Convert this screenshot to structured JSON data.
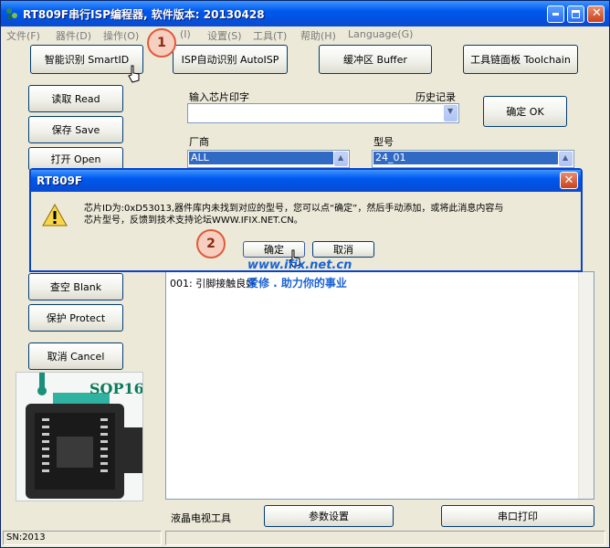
{
  "window": {
    "title": "RT809F串行ISP编程器, 软件版本: 20130428"
  },
  "menu": [
    "文件(F)",
    "器件(D)",
    "操作(O)",
    "(I)",
    "设置(S)",
    "工具(T)",
    "帮助(H)",
    "Language(G)"
  ],
  "toolbar": {
    "smartid": "智能识别 SmartID",
    "isp_auto": "ISP自动识别 AutoISP",
    "buffer": "缓冲区 Buffer",
    "toolchain": "工具链面板 Toolchain"
  },
  "sidebar": {
    "read": "读取 Read",
    "save": "保存 Save",
    "open": "打开 Open",
    "blank": "查空 Blank",
    "protect": "保护 Protect",
    "cancel": "取消 Cancel"
  },
  "chip_input": {
    "label": "输入芯片印字",
    "history_label": "历史记录",
    "value": "",
    "confirm": "确定 OK"
  },
  "vendor": {
    "label": "厂商",
    "selected": "ALL"
  },
  "model": {
    "label": "型号",
    "selected": "24_01"
  },
  "log": {
    "lines": [
      "001: 引脚接触良好"
    ]
  },
  "bottom_bar": {
    "lcd_tools": "液晶电视工具",
    "params": "参数设置",
    "serial_print": "串口打印"
  },
  "status": {
    "sn": "SN:2013",
    "message": ""
  },
  "package_photo": {
    "label": "SOP16"
  },
  "dialog": {
    "title": "RT809F",
    "message_line1": "芯片ID为:0xD53013,器件库内未找到对应的型号，您可以点“确定”，然后手动添加，或将此消息内容与",
    "message_line2": "芯片型号，反馈到技术支持论坛WWW.IFIX.NET.CN。",
    "ok": "确定",
    "cancel": "取消"
  },
  "callouts": {
    "step1": "1",
    "step2": "2"
  },
  "watermark": {
    "url": "www.ifix.net.cn",
    "slogan": "爱修 . 助力你的事业"
  },
  "icons": {
    "warning": "warning-icon",
    "close": "close-icon",
    "dropdown": "chevron-down-icon"
  }
}
